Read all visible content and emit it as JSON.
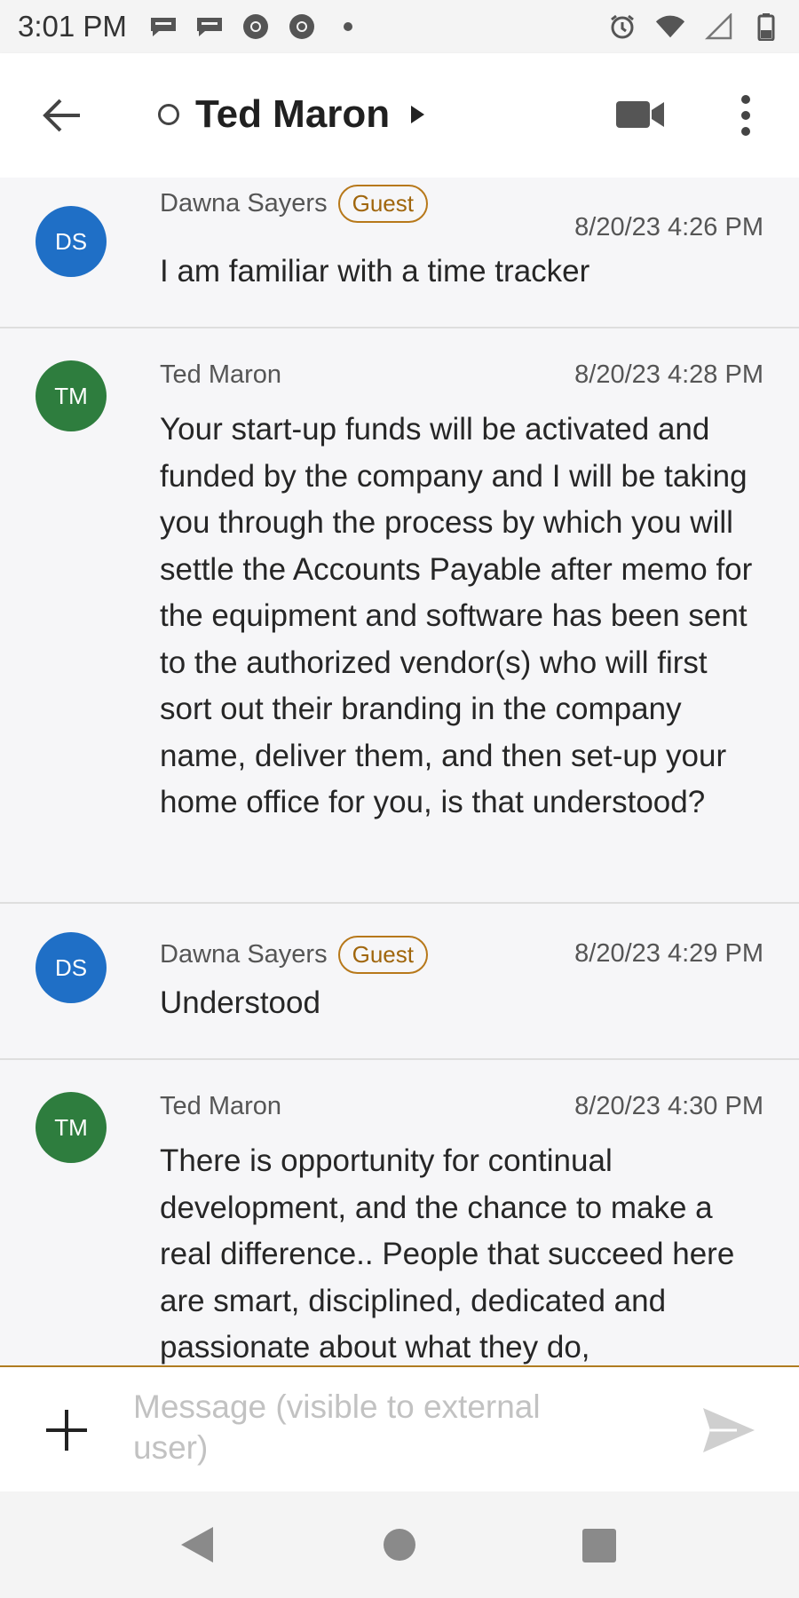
{
  "status_bar": {
    "time": "3:01 PM",
    "left_icons": [
      "chat-bubble-icon",
      "chat-bubble-icon",
      "chrome-icon",
      "chrome-icon",
      "dot-icon"
    ],
    "right_icons": [
      "alarm-icon",
      "wifi-icon",
      "signal-icon",
      "battery-icon"
    ]
  },
  "header": {
    "title": "Ted Maron",
    "presence": "offline"
  },
  "messages": [
    {
      "initials": "DS",
      "avatar_color": "#1f6fc6",
      "sender": "Dawna Sayers",
      "badge": "Guest",
      "timestamp": "8/20/23 4:26 PM",
      "text": "I am familiar with a time tracker"
    },
    {
      "initials": "TM",
      "avatar_color": "#2e7d3e",
      "sender": "Ted Maron",
      "timestamp": "8/20/23 4:28 PM",
      "text": "Your start-up funds will be activated and funded by the company and I will be taking you through the process by which you will settle the Accounts Payable after memo for the equipment and software has been sent to the authorized vendor(s) who will first sort out their branding in the company name, deliver them, and then set-up your home office for you, is that understood?"
    },
    {
      "initials": "DS",
      "avatar_color": "#1f6fc6",
      "sender": "Dawna Sayers",
      "badge": "Guest",
      "timestamp": "8/20/23 4:29 PM",
      "text": "Understood"
    },
    {
      "initials": "TM",
      "avatar_color": "#2e7d3e",
      "sender": "Ted Maron",
      "timestamp": "8/20/23 4:30 PM",
      "text": "There is opportunity for continual development, and the chance to make a real difference.. People that succeed here are smart, disciplined, dedicated and passionate about what they do,"
    }
  ],
  "composer": {
    "placeholder": "Message (visible to external user)",
    "value": ""
  },
  "colors": {
    "accent": "#b07c20",
    "guest_badge": "#b7781a",
    "send_icon": "#d0d0d0"
  }
}
